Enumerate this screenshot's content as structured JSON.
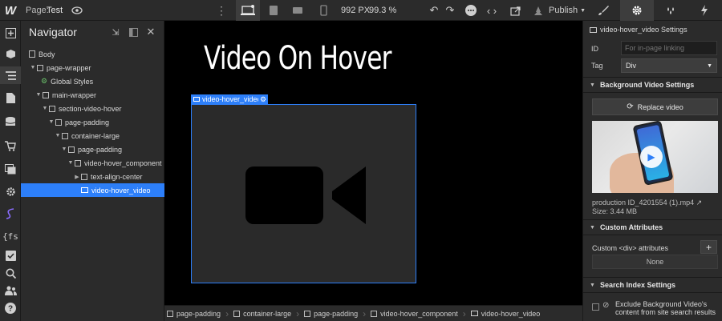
{
  "topbar": {
    "logo": "W",
    "page_label": "Page:",
    "page_name": "Test",
    "width_readout": "992 PX",
    "zoom_readout": "99.3 %",
    "publish_label": "Publish"
  },
  "navigator": {
    "title": "Navigator",
    "tree": [
      {
        "label": "Body",
        "kind": "doc"
      },
      {
        "label": "page-wrapper",
        "kind": "box"
      },
      {
        "label": "Global Styles",
        "kind": "global"
      },
      {
        "label": "main-wrapper",
        "kind": "box"
      },
      {
        "label": "section-video-hover",
        "kind": "box"
      },
      {
        "label": "page-padding",
        "kind": "box"
      },
      {
        "label": "container-large",
        "kind": "box"
      },
      {
        "label": "page-padding",
        "kind": "box"
      },
      {
        "label": "video-hover_component",
        "kind": "box"
      },
      {
        "label": "text-align-center",
        "kind": "box"
      },
      {
        "label": "video-hover_video",
        "kind": "video",
        "selected": true
      }
    ]
  },
  "canvas": {
    "heading": "Video On Hover",
    "selection_tag": "video-hover_video"
  },
  "breadcrumbs": [
    "page-padding",
    "container-large",
    "page-padding",
    "video-hover_component",
    "video-hover_video"
  ],
  "settings": {
    "title": "video-hover_video Settings",
    "id_label": "ID",
    "id_placeholder": "For in-page linking",
    "tag_label": "Tag",
    "tag_value": "Div",
    "bg_video_header": "Background Video Settings",
    "replace_label": "Replace video",
    "file_name": "production ID_4201554 (1).mp4",
    "file_size": "Size: 3.44 MB",
    "custom_attr_header": "Custom Attributes",
    "custom_attr_label": "Custom <div> attributes",
    "custom_attr_value": "None",
    "search_index_header": "Search Index Settings",
    "search_exclude_label": "Exclude Background Video's content from site search results"
  },
  "colors": {
    "accent": "#2d7ff9",
    "panel": "#2b2b2b",
    "canvas": "#000000",
    "video_box": "#2a2a2a"
  }
}
